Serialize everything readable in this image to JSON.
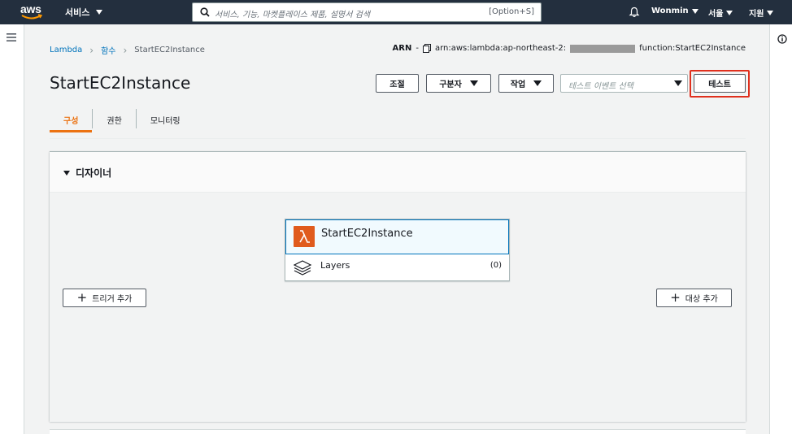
{
  "topnav": {
    "logo": "aws",
    "services": "서비스",
    "search_placeholder": "서비스, 기능, 마켓플레이스 제품, 설명서 검색",
    "search_shortcut": "[Option+S]",
    "user": "Wonmin",
    "region": "서울",
    "support": "지원"
  },
  "breadcrumb": [
    "Lambda",
    "함수",
    "StartEC2Instance"
  ],
  "arn": {
    "label": "ARN",
    "dash": "-",
    "prefix": "arn:aws:lambda:ap-northeast-2:",
    "suffix": "function:StartEC2Instance"
  },
  "title": "StartEC2Instance",
  "actions": {
    "throttle": "조절",
    "qualifiers": "구분자",
    "actions": "작업",
    "test_event_placeholder": "테스트 이벤트 선택",
    "test": "테스트"
  },
  "tabs": [
    "구성",
    "권한",
    "모니터링"
  ],
  "active_tab": "구성",
  "designer": {
    "title": "디자이너",
    "function_name": "StartEC2Instance",
    "layers_label": "Layers",
    "layers_count": "(0)",
    "add_trigger": "트리거 추가",
    "add_destination": "대상 추가"
  },
  "colors": {
    "nav_bg": "#232f3e",
    "accent": "#ec7211",
    "link": "#0073bb",
    "lambda_icon": "#e05b1d",
    "highlight": "#e0301e"
  }
}
